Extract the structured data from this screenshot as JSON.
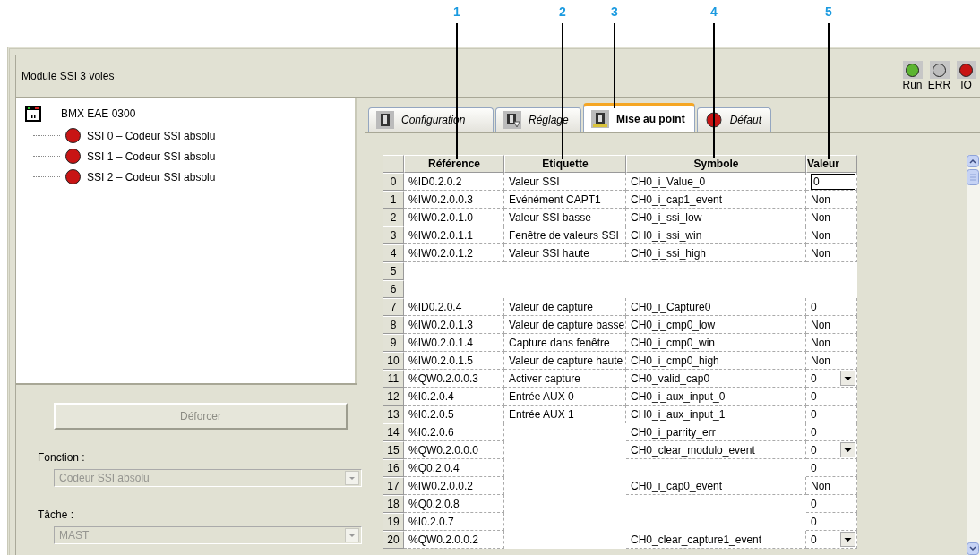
{
  "callouts": [
    {
      "label": "1"
    },
    {
      "label": "2"
    },
    {
      "label": "3"
    },
    {
      "label": "4"
    },
    {
      "label": "5"
    }
  ],
  "window": {
    "title": "Module SSI 3 voies"
  },
  "leds": [
    {
      "label": "Run",
      "color": "#5cb531"
    },
    {
      "label": "ERR",
      "color": "#bdbdbd"
    },
    {
      "label": "IO",
      "color": "#c81414"
    }
  ],
  "tree": {
    "root": "BMX EAE 0300",
    "children": [
      {
        "label": "SSI 0 – Codeur SSI absolu",
        "color": "#c81414"
      },
      {
        "label": "SSI 1 – Codeur SSI absolu",
        "color": "#c81414"
      },
      {
        "label": "SSI 2 – Codeur SSI absolu",
        "color": "#c81414"
      }
    ]
  },
  "unforce_button": {
    "label": "Déforcer",
    "disabled": true
  },
  "function_field": {
    "label": "Fonction :",
    "value": "Codeur SSI absolu",
    "disabled": true
  },
  "task_field": {
    "label": "Tâche :",
    "value": "MAST",
    "disabled": true
  },
  "tabs": [
    {
      "label": "Configuration",
      "kind": "module",
      "selected": false
    },
    {
      "label": "Réglage",
      "kind": "adjust",
      "selected": false
    },
    {
      "label": "Mise au point",
      "kind": "debug",
      "selected": true
    },
    {
      "label": "Défaut",
      "kind": "fault",
      "selected": false
    }
  ],
  "table": {
    "columns": [
      "Référence",
      "Etiquette",
      "Symbole",
      "Valeur"
    ],
    "rows": [
      {
        "number": "0",
        "reference": "%ID0.2.0.2",
        "label": "Valeur SSI",
        "symbol": "CH0_i_Value_0",
        "value": "0",
        "kind": "edit"
      },
      {
        "number": "1",
        "reference": "%IW0.2.0.0.3",
        "label": "Evénément CAPT1",
        "symbol": "CH0_i_cap1_event",
        "value": "Non",
        "kind": "text"
      },
      {
        "number": "2",
        "reference": "%IW0.2.0.1.0",
        "label": "Valeur SSI basse",
        "symbol": "CH0_i_ssi_low",
        "value": "Non",
        "kind": "text"
      },
      {
        "number": "3",
        "reference": "%IW0.2.0.1.1",
        "label": "Fenêtre de valeurs SSI",
        "symbol": "CH0_i_ssi_win",
        "value": "Non",
        "kind": "text"
      },
      {
        "number": "4",
        "reference": "%IW0.2.0.1.2",
        "label": "Valeur SSI haute",
        "symbol": "CH0_i_ssi_high",
        "value": "Non",
        "kind": "text"
      },
      {
        "number": "5",
        "kind": "blank"
      },
      {
        "number": "6",
        "kind": "blank"
      },
      {
        "number": "7",
        "reference": "%ID0.2.0.4",
        "label": "Valeur de capture",
        "symbol": "CH0_i_Capture0",
        "value": "0",
        "kind": "text"
      },
      {
        "number": "8",
        "reference": "%IW0.2.0.1.3",
        "label": "Valeur de capture basse",
        "symbol": "CH0_i_cmp0_low",
        "value": "Non",
        "kind": "text"
      },
      {
        "number": "9",
        "reference": "%IW0.2.0.1.4",
        "label": "Capture dans fenêtre",
        "symbol": "CH0_i_cmp0_win",
        "value": "Non",
        "kind": "text"
      },
      {
        "number": "10",
        "reference": "%IW0.2.0.1.5",
        "label": "Valeur de capture haute",
        "symbol": "CH0_i_cmp0_high",
        "value": "Non",
        "kind": "text"
      },
      {
        "number": "11",
        "reference": "%QW0.2.0.0.3",
        "label": "Activer capture",
        "symbol": "CH0_valid_cap0",
        "value": "0",
        "kind": "dropdown"
      },
      {
        "number": "12",
        "reference": "%I0.2.0.4",
        "label": "Entrée AUX 0",
        "symbol": "CH0_i_aux_input_0",
        "value": "0",
        "kind": "text"
      },
      {
        "number": "13",
        "reference": "%I0.2.0.5",
        "label": "Entrée AUX 1",
        "symbol": "CH0_i_aux_input_1",
        "value": "0",
        "kind": "text"
      },
      {
        "number": "14",
        "reference": "%I0.2.0.6",
        "symbol": "CH0_i_parrity_err",
        "value": "0",
        "kind": "text"
      },
      {
        "number": "15",
        "reference": "%QW0.2.0.0.0",
        "symbol": "CH0_clear_modulo_event",
        "value": "0",
        "kind": "dropdown"
      },
      {
        "number": "16",
        "reference": "%Q0.2.0.4",
        "value": "0",
        "kind": "text"
      },
      {
        "number": "17",
        "reference": "%IW0.2.0.0.2",
        "symbol": "CH0_i_cap0_event",
        "value": "Non",
        "kind": "text"
      },
      {
        "number": "18",
        "reference": "%Q0.2.0.8",
        "value": "0",
        "kind": "text"
      },
      {
        "number": "19",
        "reference": "%I0.2.0.7",
        "value": "0",
        "kind": "text"
      },
      {
        "number": "20",
        "reference": "%QW0.2.0.0.2",
        "symbol": "CH0_clear_capture1_event",
        "value": "0",
        "kind": "dropdown"
      }
    ]
  }
}
